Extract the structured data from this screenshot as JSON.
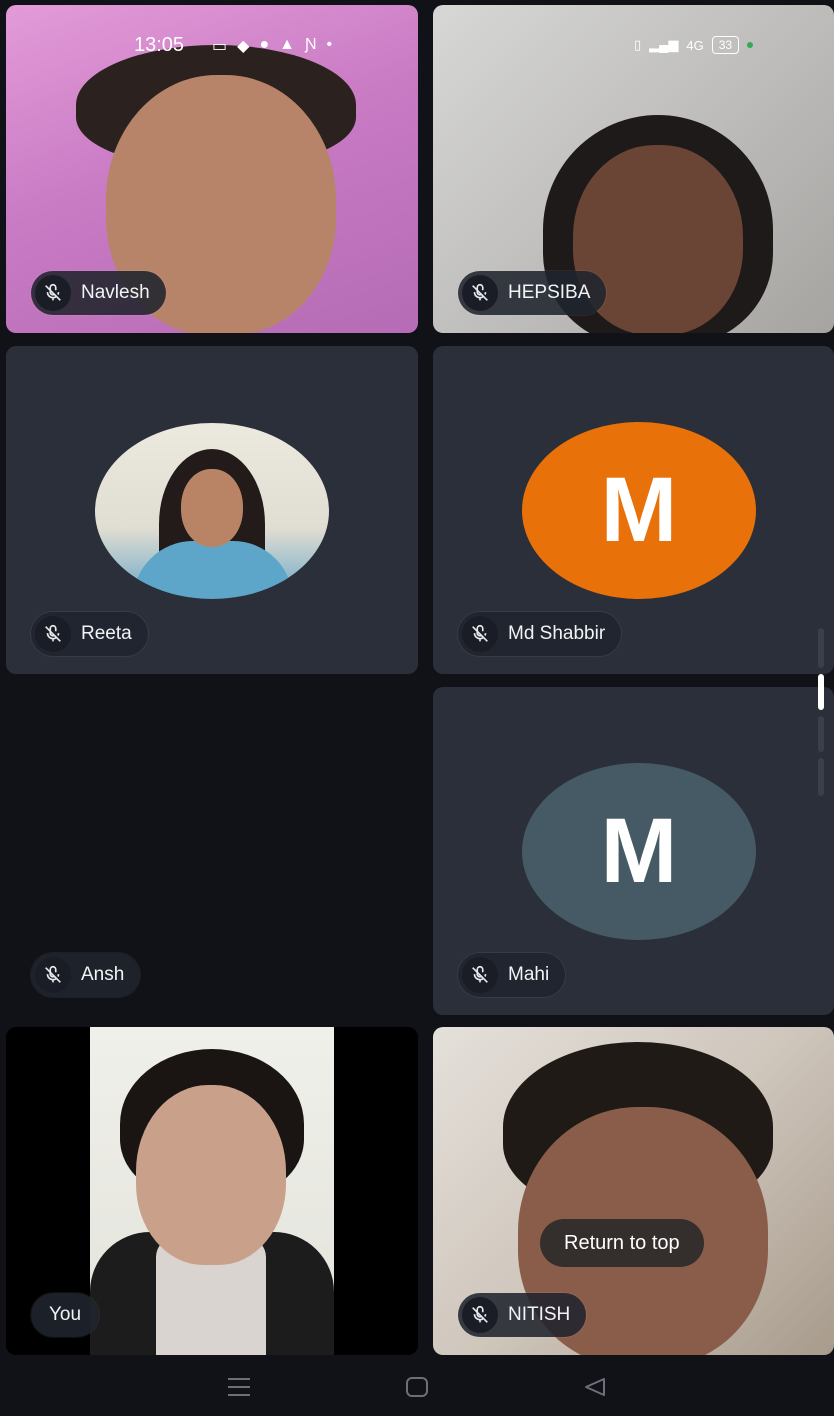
{
  "status_bar": {
    "time": "13:05",
    "battery": "33",
    "network": "4G"
  },
  "participants": [
    {
      "name": "Navlesh",
      "muted": true,
      "video": true
    },
    {
      "name": "HEPSIBA",
      "muted": true,
      "video": true
    },
    {
      "name": "Reeta",
      "muted": true,
      "avatar": "photo"
    },
    {
      "name": "Md Shabbir",
      "muted": true,
      "avatar_letter": "M",
      "avatar_color": "#e8710a"
    },
    {
      "name": "Ansh",
      "muted": true,
      "video": false
    },
    {
      "name": "Mahi",
      "muted": true,
      "avatar_letter": "M",
      "avatar_color": "#455a64"
    },
    {
      "name": "You",
      "muted": false,
      "video": true
    },
    {
      "name": "NITISH",
      "muted": true,
      "video": true
    }
  ],
  "return_to_top": "Return to top",
  "icons": {
    "mic_off": "mic-off-icon",
    "nav_recents": "recents-icon",
    "nav_home": "home-icon",
    "nav_back": "back-icon"
  }
}
